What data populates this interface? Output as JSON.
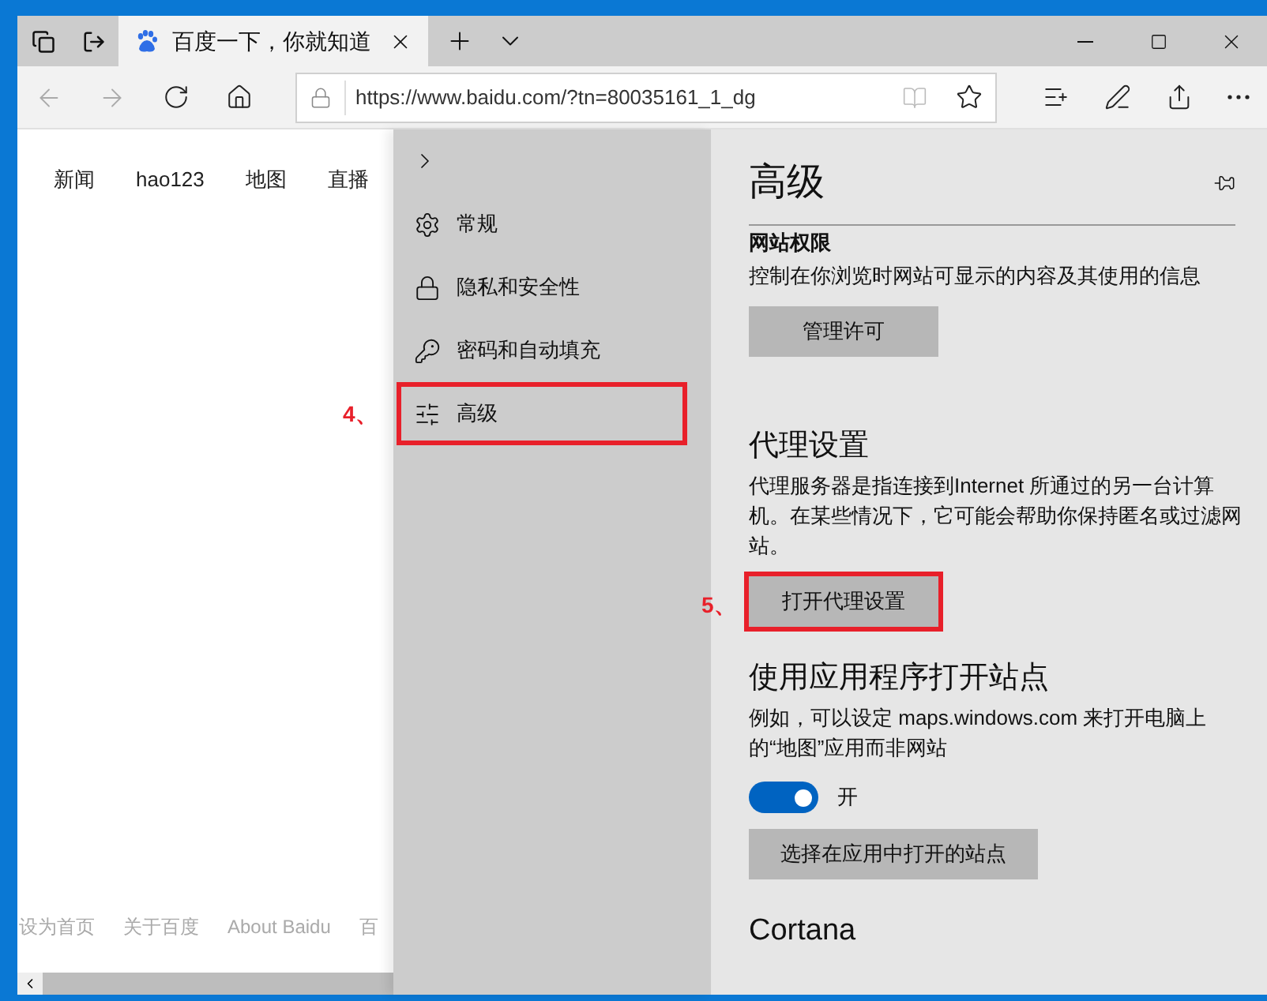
{
  "tab_bar": {
    "tabs": [
      {
        "title": "百度一下，你就知道",
        "selected": true
      }
    ]
  },
  "address_bar": {
    "url": "https://www.baidu.com/?tn=80035161_1_dg"
  },
  "page": {
    "nav_links": [
      "新闻",
      "hao123",
      "地图",
      "直播"
    ],
    "footer_links": [
      "设为首页",
      "关于百度",
      "About Baidu",
      "百"
    ]
  },
  "sidebar": {
    "items": [
      {
        "kind": "general",
        "label": "常规",
        "highlighted": false
      },
      {
        "kind": "privacy",
        "label": "隐私和安全性",
        "highlighted": false
      },
      {
        "kind": "passwords",
        "label": "密码和自动填充",
        "highlighted": false
      },
      {
        "kind": "advanced",
        "label": "高级",
        "highlighted": true,
        "annotation": "4、"
      }
    ]
  },
  "settings": {
    "title": "高级",
    "sections": [
      {
        "kind": "subsection",
        "title": "网站权限",
        "description": "控制在你浏览时网站可显示的内容及其使用的信息",
        "button": "管理许可",
        "highlighted": false
      },
      {
        "kind": "section",
        "title": "代理设置",
        "description": "代理服务器是指连接到Internet 所通过的另一台计算机。在某些情况下，它可能会帮助你保持匿名或过滤网站。",
        "button": "打开代理设置",
        "highlighted": true,
        "annotation": "5、"
      },
      {
        "kind": "section",
        "title": "使用应用程序打开站点",
        "description": "例如，可以设定 maps.windows.com 来打开电脑上的“地图”应用而非网站",
        "toggle": {
          "on": true,
          "label": "开"
        },
        "button": "选择在应用中打开的站点",
        "highlighted": false
      },
      {
        "kind": "section",
        "title": "Cortana"
      }
    ]
  }
}
